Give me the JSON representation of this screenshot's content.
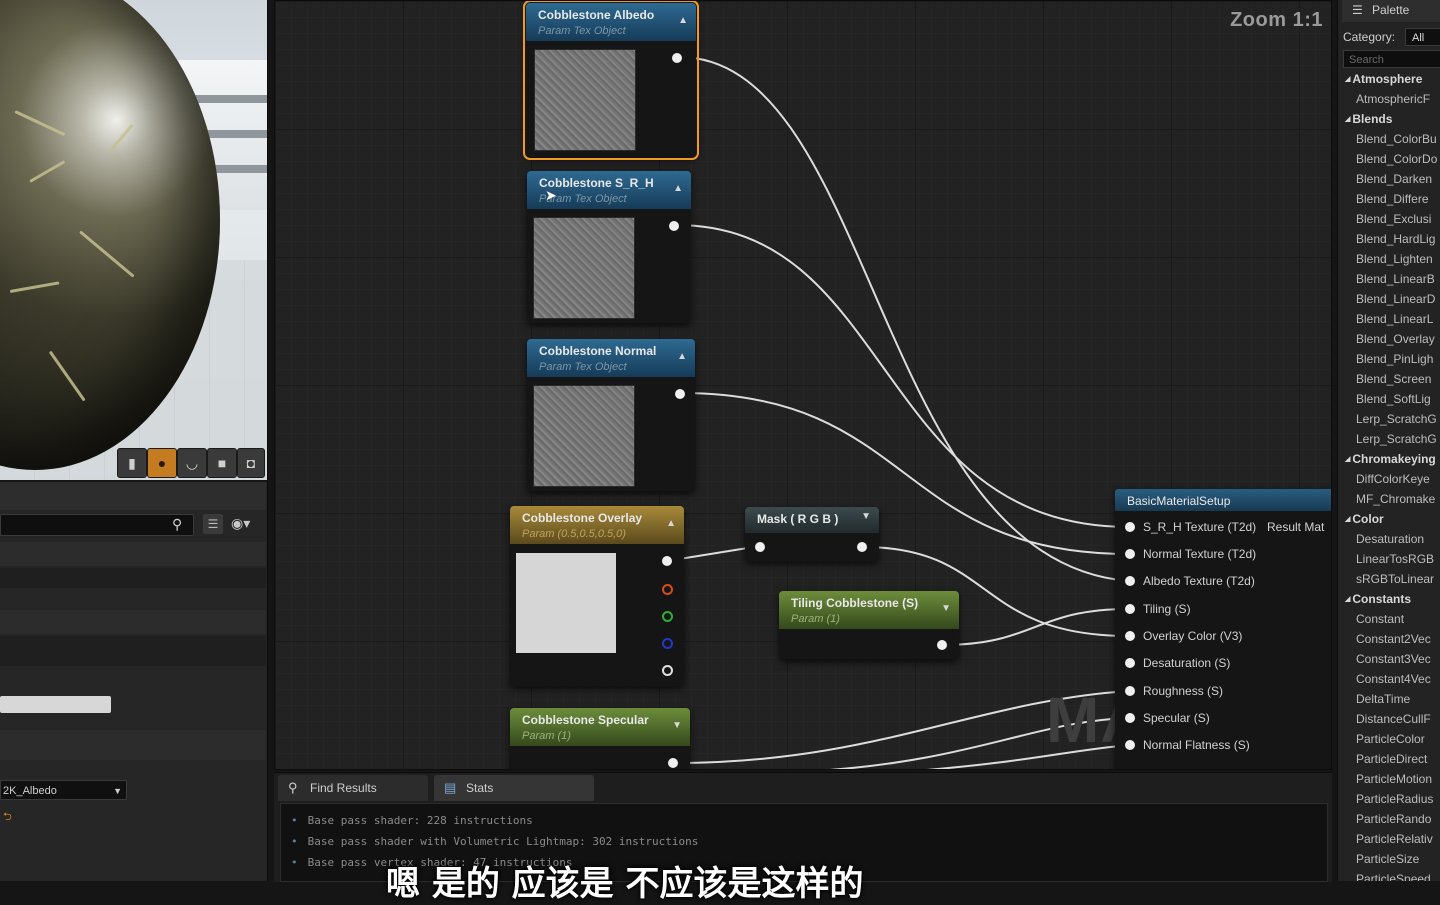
{
  "graph": {
    "zoom_label": "Zoom 1:1",
    "watermark": "MATERIAL",
    "nodes": {
      "albedo": {
        "title": "Cobblestone Albedo",
        "subtitle": "Param Tex Object"
      },
      "srh": {
        "title": "Cobblestone S_R_H",
        "subtitle": "Param Tex Object"
      },
      "normal": {
        "title": "Cobblestone Normal",
        "subtitle": "Param Tex Object"
      },
      "overlay": {
        "title": "Cobblestone Overlay",
        "subtitle": "Param (0.5,0.5,0.5,0)"
      },
      "specular": {
        "title": "Cobblestone Specular",
        "subtitle": "Param (1)"
      },
      "mask": {
        "title": "Mask ( R G B )"
      },
      "tiling": {
        "title": "Tiling Cobblestone (S)",
        "subtitle": "Param (1)"
      },
      "material": {
        "title": "BasicMaterialSetup",
        "output_label": "Result Mat",
        "inputs": [
          "S_R_H Texture (T2d)",
          "Normal Texture (T2d)",
          "Albedo Texture (T2d)",
          "Tiling (S)",
          "Overlay Color (V3)",
          "Desaturation (S)",
          "Roughness (S)",
          "Specular (S)",
          "Normal Flatness (S)"
        ]
      }
    }
  },
  "left_panel": {
    "texture_value": "2K_Albedo"
  },
  "bottom": {
    "tabs": [
      {
        "label": "Find Results",
        "icon": "search-icon"
      },
      {
        "label": "Stats",
        "icon": "stats-icon"
      }
    ],
    "stats": [
      "Base pass shader: 228 instructions",
      "Base pass shader with Volumetric Lightmap: 302 instructions",
      "Base pass vertex shader: 47 instructions"
    ]
  },
  "subtitle": "嗯 是的 应该是 不应该是这样的",
  "palette": {
    "tab_label": "Palette",
    "category_label": "Category:",
    "category_value": "All",
    "search_placeholder": "Search",
    "groups": [
      {
        "name": "Atmosphere",
        "items": [
          "AtmosphericF"
        ]
      },
      {
        "name": "Blends",
        "items": [
          "Blend_ColorBu",
          "Blend_ColorDo",
          "Blend_Darken",
          "Blend_Differe",
          "Blend_Exclusi",
          "Blend_HardLig",
          "Blend_Lighten",
          "Blend_LinearB",
          "Blend_LinearD",
          "Blend_LinearL",
          "Blend_Overlay",
          "Blend_PinLigh",
          "Blend_Screen",
          "Blend_SoftLig",
          "Lerp_ScratchG",
          "Lerp_ScratchG"
        ]
      },
      {
        "name": "Chromakeying",
        "items": [
          "DiffColorKeye",
          "MF_Chromake"
        ]
      },
      {
        "name": "Color",
        "items": [
          "Desaturation",
          "LinearTosRGB",
          "sRGBToLinear"
        ]
      },
      {
        "name": "Constants",
        "items": [
          "Constant",
          "Constant2Vec",
          "Constant3Vec",
          "Constant4Vec",
          "DeltaTime",
          "DistanceCullF",
          "ParticleColor",
          "ParticleDirect",
          "ParticleMotion",
          "ParticleRadius",
          "ParticleRando",
          "ParticleRelativ",
          "ParticleSize",
          "ParticleSpeed"
        ]
      }
    ]
  },
  "colors": {
    "selection_outline": "#f09a22",
    "texture_header": "#2e6a92",
    "vector_header": "#a88a39",
    "scalar_header": "#6d8d3b"
  }
}
